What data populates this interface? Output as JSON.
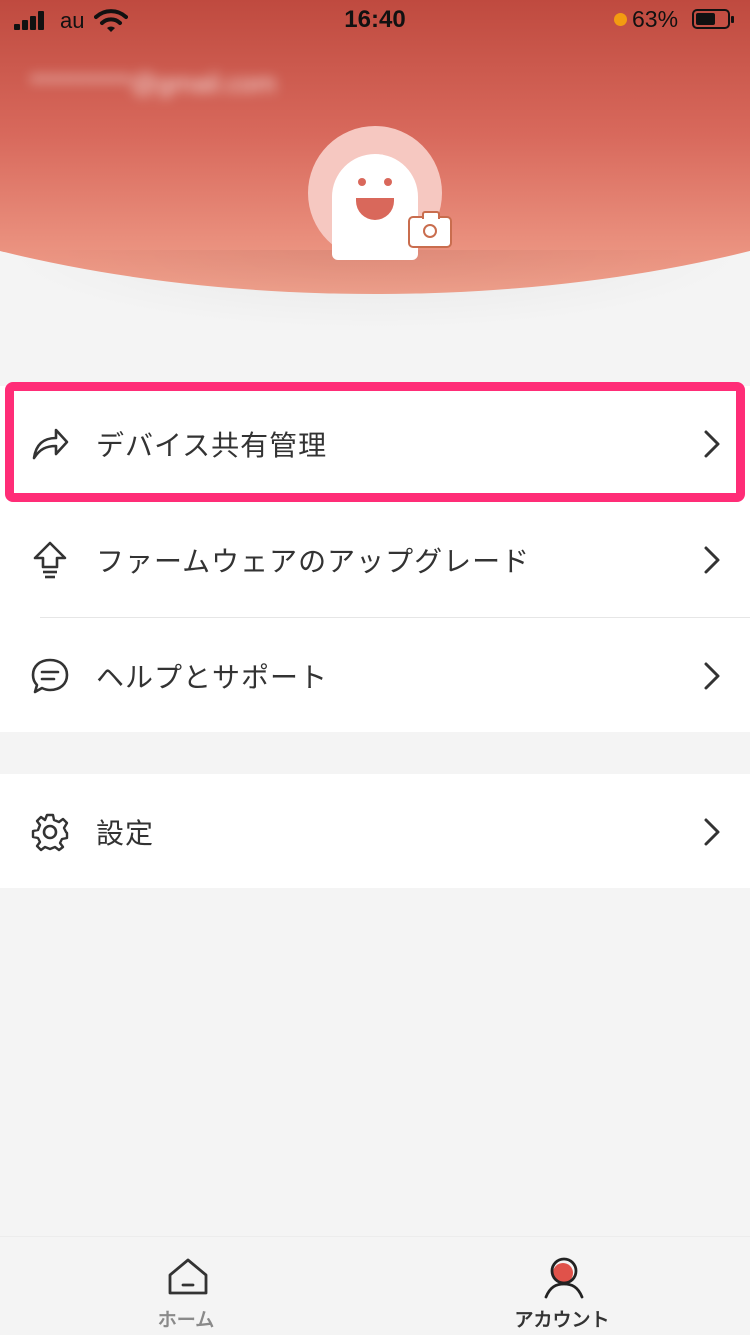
{
  "status_bar": {
    "carrier": "au",
    "time": "16:40",
    "battery_percent": "63%",
    "battery_level": 0.63
  },
  "header": {
    "email": "**********@gmail.com"
  },
  "menu": {
    "items": [
      {
        "label": "デバイス共有管理",
        "icon": "share-icon"
      },
      {
        "label": "ファームウェアのアップグレード",
        "icon": "upgrade-arrow-icon"
      },
      {
        "label": "ヘルプとサポート",
        "icon": "chat-bubble-icon"
      }
    ],
    "settings": {
      "label": "設定",
      "icon": "gear-icon"
    }
  },
  "tabbar": {
    "home_label": "ホーム",
    "account_label": "アカウント"
  },
  "colors": {
    "header_top": "#bf4a3f",
    "header_bottom": "#f3a48f",
    "highlight": "#ff2d77",
    "accent": "#d9685b"
  }
}
